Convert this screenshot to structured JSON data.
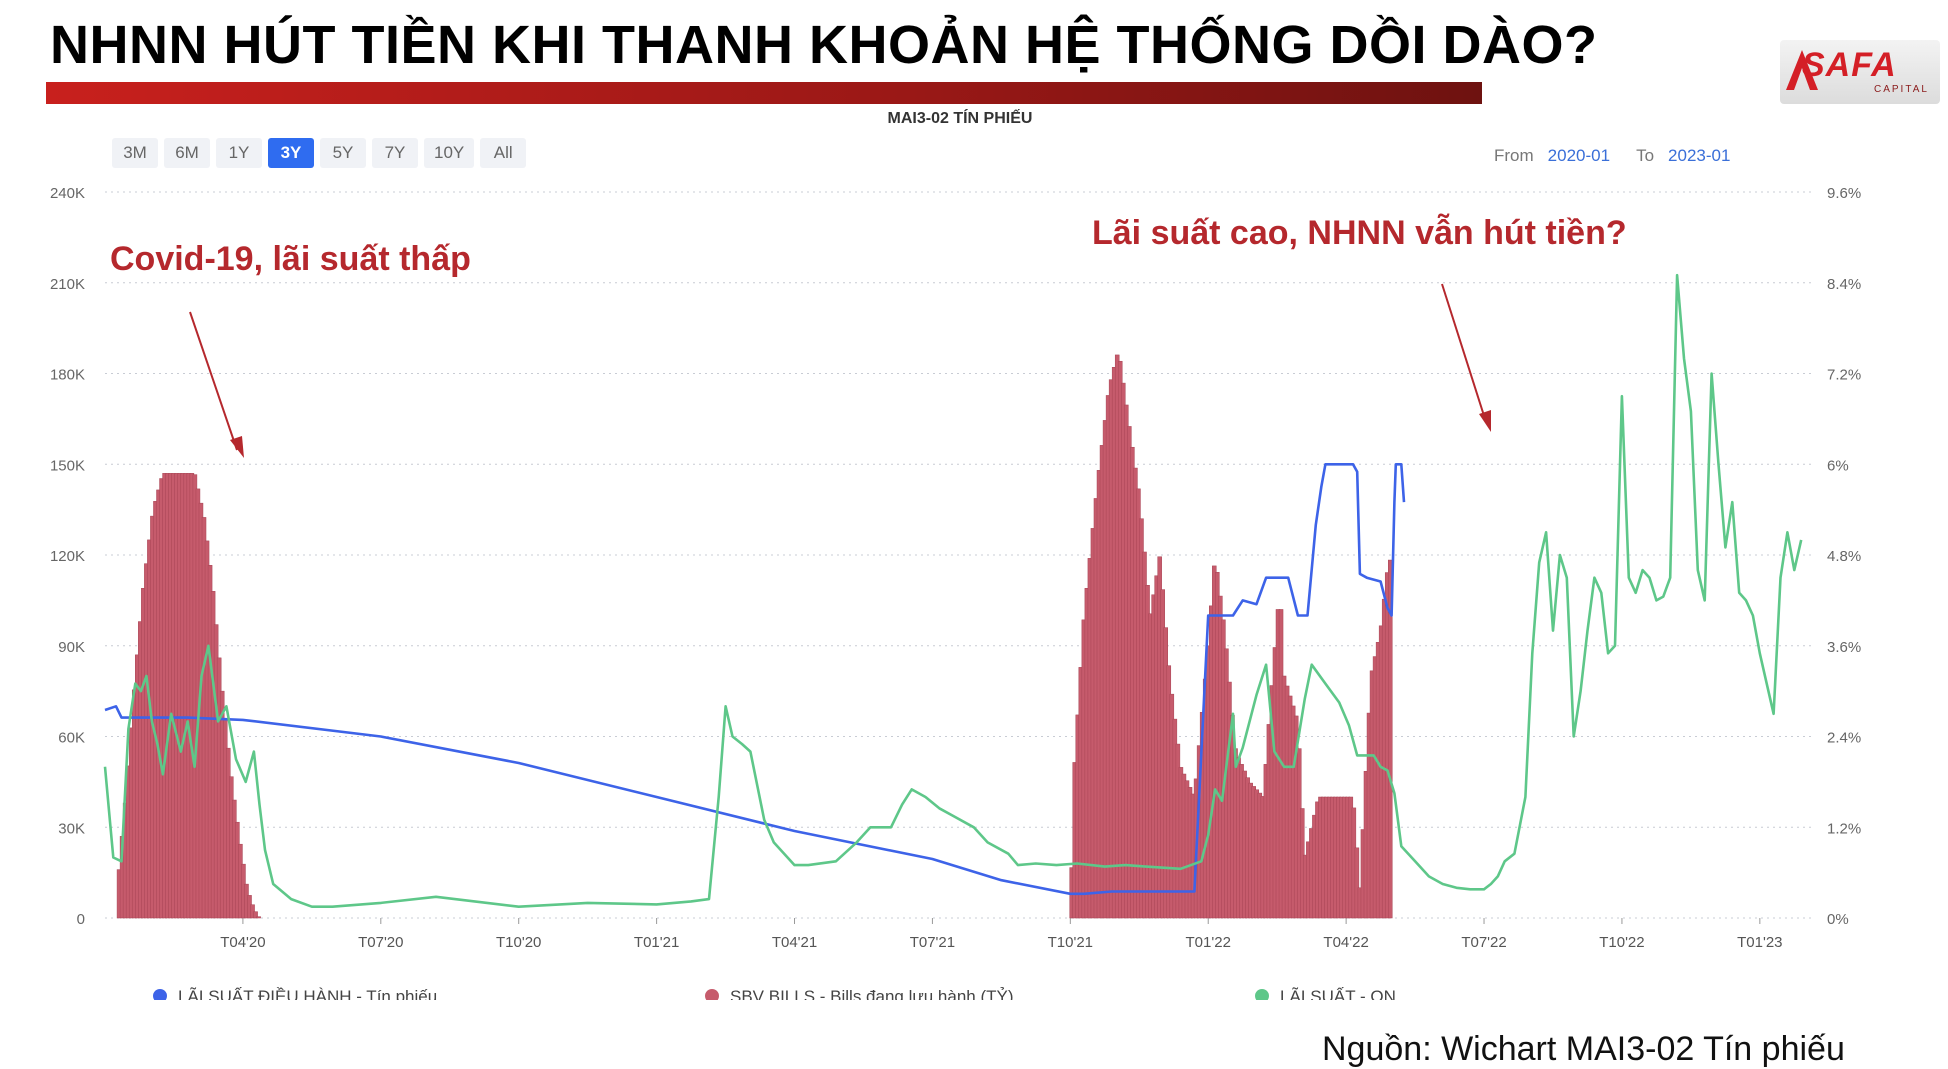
{
  "slide": {
    "title": "NHNN HÚT TIỀN KHI THANH KHOẢN HỆ THỐNG DỒI DÀO?",
    "source": "Nguồn: Wichart MAI3-02 Tín phiếu",
    "logo_text": "SAFA",
    "logo_sub": "CAPITAL"
  },
  "toolbar": {
    "ranges": [
      "3M",
      "6M",
      "1Y",
      "3Y",
      "5Y",
      "7Y",
      "10Y",
      "All"
    ],
    "active_range": "3Y",
    "from_label": "From",
    "from_value": "2020-01",
    "to_label": "To",
    "to_value": "2023-01"
  },
  "annotations": {
    "left": "Covid-19, lãi suất thấp",
    "right": "Lãi suất cao, NHNN vẫn hút tiền?"
  },
  "colors": {
    "bars": "#c65b6c",
    "blue_line": "#3d63e8",
    "green_line": "#5ec789",
    "annotation": "#b5282d"
  },
  "chart_data": {
    "type": "bar",
    "title": "MAI3-02 TÍN PHIẾU",
    "x_range": [
      "2020-01",
      "2023-01"
    ],
    "x_ticks": [
      "T04'20",
      "T07'20",
      "T10'20",
      "T01'21",
      "T04'21",
      "T07'21",
      "T10'21",
      "T01'22",
      "T04'22",
      "T07'22",
      "T10'22",
      "T01'23"
    ],
    "y_left_ticks": [
      "240K",
      "210K",
      "180K",
      "150K",
      "120K",
      "90K",
      "60K",
      "30K",
      "0"
    ],
    "y_left_range": [
      0,
      240000
    ],
    "y_right_ticks": [
      "9.6%",
      "8.4%",
      "7.2%",
      "6%",
      "4.8%",
      "3.6%",
      "2.4%",
      "1.2%",
      "0%"
    ],
    "y_right_range": [
      0,
      9.6
    ],
    "legend_position": "bottom",
    "series": [
      {
        "name": "SBV BILLS - Bills đang lưu hành (TỶ)",
        "type": "bar",
        "axis": "left",
        "points": [
          [
            0.08,
            0
          ],
          [
            0.1,
            15000
          ],
          [
            0.15,
            40000
          ],
          [
            0.22,
            80000
          ],
          [
            0.28,
            110000
          ],
          [
            0.35,
            135000
          ],
          [
            0.42,
            147000
          ],
          [
            0.55,
            147000
          ],
          [
            0.65,
            147000
          ],
          [
            0.72,
            132000
          ],
          [
            0.78,
            110000
          ],
          [
            0.85,
            75000
          ],
          [
            0.92,
            45000
          ],
          [
            0.98,
            25000
          ],
          [
            1.03,
            10000
          ],
          [
            1.08,
            3000
          ],
          [
            1.12,
            0
          ],
          [
            7.0,
            0
          ],
          [
            7.03,
            50000
          ],
          [
            7.1,
            100000
          ],
          [
            7.2,
            145000
          ],
          [
            7.28,
            175000
          ],
          [
            7.35,
            188000
          ],
          [
            7.42,
            165000
          ],
          [
            7.5,
            140000
          ],
          [
            7.58,
            100000
          ],
          [
            7.65,
            120000
          ],
          [
            7.72,
            80000
          ],
          [
            7.8,
            50000
          ],
          [
            7.9,
            40000
          ],
          [
            8.0,
            90000
          ],
          [
            8.05,
            120000
          ],
          [
            8.12,
            95000
          ],
          [
            8.2,
            55000
          ],
          [
            8.3,
            45000
          ],
          [
            8.4,
            40000
          ],
          [
            8.45,
            70000
          ],
          [
            8.52,
            110000
          ],
          [
            8.55,
            80000
          ],
          [
            8.65,
            65000
          ],
          [
            8.7,
            20000
          ],
          [
            8.8,
            40000
          ],
          [
            8.9,
            40000
          ],
          [
            9.0,
            40000
          ],
          [
            9.05,
            40000
          ],
          [
            9.1,
            10000
          ],
          [
            9.18,
            80000
          ],
          [
            9.25,
            95000
          ],
          [
            9.3,
            115000
          ],
          [
            9.33,
            120000
          ]
        ]
      },
      {
        "name": "LÃI SUẤT ĐIỀU HÀNH - Tín phiếu",
        "type": "line",
        "axis": "right",
        "points": [
          [
            0.0,
            2.75
          ],
          [
            0.08,
            2.8
          ],
          [
            0.12,
            2.65
          ],
          [
            0.3,
            2.65
          ],
          [
            0.6,
            2.65
          ],
          [
            1.0,
            2.62
          ],
          [
            2.0,
            2.4
          ],
          [
            3.0,
            2.05
          ],
          [
            4.0,
            1.6
          ],
          [
            5.0,
            1.15
          ],
          [
            6.0,
            0.78
          ],
          [
            6.5,
            0.5
          ],
          [
            7.0,
            0.32
          ],
          [
            7.1,
            0.32
          ],
          [
            7.3,
            0.35
          ],
          [
            7.9,
            0.35
          ],
          [
            8.0,
            4.0
          ],
          [
            8.12,
            4.0
          ],
          [
            8.18,
            4.0
          ],
          [
            8.25,
            4.2
          ],
          [
            8.35,
            4.15
          ],
          [
            8.42,
            4.5
          ],
          [
            8.5,
            4.5
          ],
          [
            8.58,
            4.5
          ],
          [
            8.65,
            4.0
          ],
          [
            8.72,
            4.0
          ],
          [
            8.78,
            5.2
          ],
          [
            8.82,
            5.7
          ],
          [
            8.85,
            6.0
          ],
          [
            9.05,
            6.0
          ],
          [
            9.08,
            5.9
          ],
          [
            9.1,
            4.55
          ],
          [
            9.15,
            4.5
          ],
          [
            9.25,
            4.45
          ],
          [
            9.3,
            4.1
          ],
          [
            9.33,
            4.0
          ],
          [
            9.35,
            5.5
          ],
          [
            9.36,
            6.0
          ],
          [
            9.4,
            6.0
          ],
          [
            9.42,
            5.5
          ]
        ]
      },
      {
        "name": "LÃI SUẤT - ON",
        "type": "line",
        "axis": "right",
        "points": [
          [
            0.0,
            2.0
          ],
          [
            0.04,
            1.2
          ],
          [
            0.06,
            0.8
          ],
          [
            0.12,
            0.75
          ],
          [
            0.17,
            2.5
          ],
          [
            0.22,
            3.1
          ],
          [
            0.26,
            3.0
          ],
          [
            0.3,
            3.2
          ],
          [
            0.34,
            2.6
          ],
          [
            0.38,
            2.3
          ],
          [
            0.42,
            1.9
          ],
          [
            0.48,
            2.7
          ],
          [
            0.55,
            2.2
          ],
          [
            0.6,
            2.6
          ],
          [
            0.65,
            2.0
          ],
          [
            0.7,
            3.2
          ],
          [
            0.75,
            3.6
          ],
          [
            0.82,
            2.6
          ],
          [
            0.88,
            2.8
          ],
          [
            0.95,
            2.1
          ],
          [
            1.02,
            1.8
          ],
          [
            1.08,
            2.2
          ],
          [
            1.12,
            1.5
          ],
          [
            1.16,
            0.9
          ],
          [
            1.22,
            0.45
          ],
          [
            1.35,
            0.25
          ],
          [
            1.5,
            0.15
          ],
          [
            1.65,
            0.15
          ],
          [
            2.0,
            0.2
          ],
          [
            2.4,
            0.28
          ],
          [
            3.0,
            0.15
          ],
          [
            3.5,
            0.2
          ],
          [
            4.0,
            0.18
          ],
          [
            4.25,
            0.22
          ],
          [
            4.38,
            0.25
          ],
          [
            4.45,
            1.6
          ],
          [
            4.5,
            2.8
          ],
          [
            4.55,
            2.4
          ],
          [
            4.62,
            2.3
          ],
          [
            4.68,
            2.2
          ],
          [
            4.78,
            1.3
          ],
          [
            4.85,
            1.0
          ],
          [
            5.0,
            0.7
          ],
          [
            5.1,
            0.7
          ],
          [
            5.3,
            0.75
          ],
          [
            5.45,
            1.0
          ],
          [
            5.55,
            1.2
          ],
          [
            5.7,
            1.2
          ],
          [
            5.78,
            1.5
          ],
          [
            5.85,
            1.7
          ],
          [
            5.95,
            1.6
          ],
          [
            6.05,
            1.45
          ],
          [
            6.15,
            1.35
          ],
          [
            6.3,
            1.2
          ],
          [
            6.4,
            1.0
          ],
          [
            6.55,
            0.85
          ],
          [
            6.62,
            0.7
          ],
          [
            6.75,
            0.72
          ],
          [
            6.9,
            0.7
          ],
          [
            7.05,
            0.72
          ],
          [
            7.25,
            0.68
          ],
          [
            7.4,
            0.7
          ],
          [
            7.55,
            0.68
          ],
          [
            7.8,
            0.65
          ],
          [
            7.95,
            0.75
          ],
          [
            8.0,
            1.1
          ],
          [
            8.05,
            1.7
          ],
          [
            8.1,
            1.55
          ],
          [
            8.18,
            2.7
          ],
          [
            8.2,
            2.0
          ],
          [
            8.25,
            2.25
          ],
          [
            8.35,
            2.95
          ],
          [
            8.42,
            3.35
          ],
          [
            8.48,
            2.2
          ],
          [
            8.55,
            2.0
          ],
          [
            8.62,
            2.0
          ],
          [
            8.7,
            2.9
          ],
          [
            8.75,
            3.35
          ],
          [
            8.85,
            3.1
          ],
          [
            8.95,
            2.85
          ],
          [
            9.02,
            2.55
          ],
          [
            9.08,
            2.15
          ],
          [
            9.12,
            2.15
          ],
          [
            9.2,
            2.15
          ],
          [
            9.25,
            2.0
          ],
          [
            9.3,
            1.95
          ],
          [
            9.35,
            1.65
          ],
          [
            9.4,
            0.95
          ],
          [
            9.5,
            0.75
          ],
          [
            9.6,
            0.55
          ],
          [
            9.7,
            0.45
          ],
          [
            9.8,
            0.4
          ],
          [
            9.9,
            0.38
          ],
          [
            10.0,
            0.38
          ],
          [
            10.05,
            0.45
          ],
          [
            10.1,
            0.55
          ],
          [
            10.15,
            0.75
          ],
          [
            10.22,
            0.85
          ],
          [
            10.3,
            1.6
          ],
          [
            10.35,
            3.5
          ],
          [
            10.4,
            4.7
          ],
          [
            10.45,
            5.1
          ],
          [
            10.5,
            3.8
          ],
          [
            10.55,
            4.8
          ],
          [
            10.6,
            4.5
          ],
          [
            10.65,
            2.4
          ],
          [
            10.7,
            3.0
          ],
          [
            10.75,
            3.8
          ],
          [
            10.8,
            4.5
          ],
          [
            10.85,
            4.3
          ],
          [
            10.9,
            3.5
          ],
          [
            10.95,
            3.6
          ],
          [
            11.0,
            6.9
          ],
          [
            11.05,
            4.5
          ],
          [
            11.1,
            4.3
          ],
          [
            11.15,
            4.6
          ],
          [
            11.2,
            4.5
          ],
          [
            11.25,
            4.2
          ],
          [
            11.3,
            4.25
          ],
          [
            11.35,
            4.5
          ],
          [
            11.4,
            8.5
          ],
          [
            11.45,
            7.4
          ],
          [
            11.5,
            6.7
          ],
          [
            11.55,
            4.6
          ],
          [
            11.6,
            4.2
          ],
          [
            11.65,
            7.2
          ],
          [
            11.7,
            6.0
          ],
          [
            11.75,
            4.9
          ],
          [
            11.8,
            5.5
          ],
          [
            11.85,
            4.3
          ],
          [
            11.9,
            4.2
          ],
          [
            11.95,
            4.0
          ],
          [
            12.0,
            3.5
          ],
          [
            12.05,
            3.1
          ],
          [
            12.1,
            2.7
          ],
          [
            12.15,
            4.5
          ],
          [
            12.2,
            5.1
          ],
          [
            12.25,
            4.6
          ],
          [
            12.3,
            5.0
          ]
        ]
      }
    ]
  }
}
